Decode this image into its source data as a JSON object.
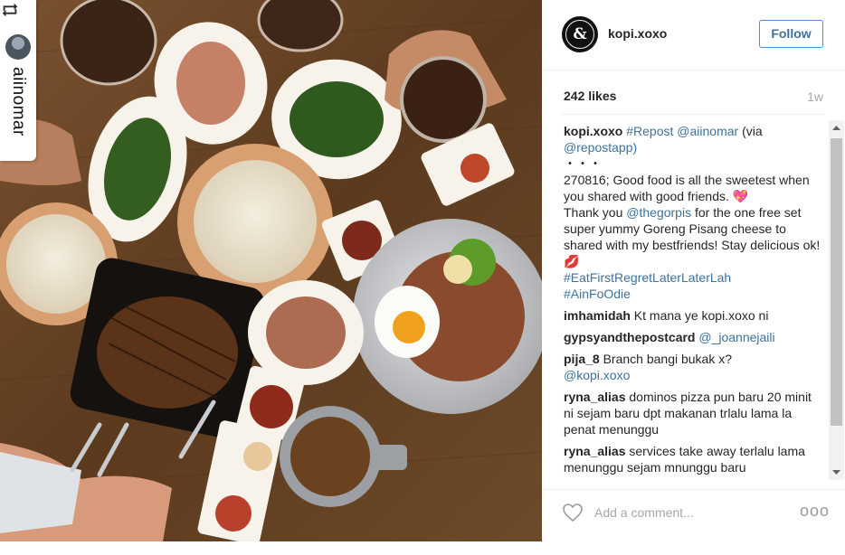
{
  "photo": {
    "alt_icon": "photo-food-table",
    "repost": {
      "icon": "repost-icon",
      "username": "aiinomar"
    }
  },
  "post": {
    "username": "kopi.xoxo",
    "avatar_text": "&",
    "follow_label": "Follow",
    "likes": "242 likes",
    "time": "1w"
  },
  "caption": {
    "user": "kopi.xoxo",
    "repost_tag": "#Repost",
    "repost_user": "@aiinomar",
    "via_open": "(via",
    "via_user": "@repostapp)",
    "dots": "・・・",
    "line1": "270816; Good food is all the sweetest when you shared with good friends. 💖",
    "line2_pre": "Thank you",
    "line2_user": "@thegorpis",
    "line2_post": "for the one free set super yummy Goreng Pisang cheese to shared with my bestfriends! Stay delicious ok! 💋",
    "tag1": "#EatFirstRegretLaterLaterLah",
    "tag2": "#AinFoOdie"
  },
  "comments": [
    {
      "user": "imhamidah",
      "text": "Kt mana ye kopi.xoxo ni"
    },
    {
      "user": "gypsyandthepostcard",
      "mention": "@_joannejaili"
    },
    {
      "user": "pija_8",
      "text": "Branch bangi bukak x?",
      "mention": "@kopi.xoxo"
    },
    {
      "user": "ryna_alias",
      "text": "dominos pizza pun baru 20 minit ni sejam baru dpt makanan trlalu lama la penat menunggu"
    },
    {
      "user": "ryna_alias",
      "text": "services take away terlalu lama menunggu sejam mnunggu baru"
    }
  ],
  "footer": {
    "placeholder": "Add a comment...",
    "more": "ooo"
  },
  "colors": {
    "link": "#3f729b",
    "follow_border": "#4b8fd0",
    "text": "#262626",
    "muted": "#a5a7aa"
  }
}
